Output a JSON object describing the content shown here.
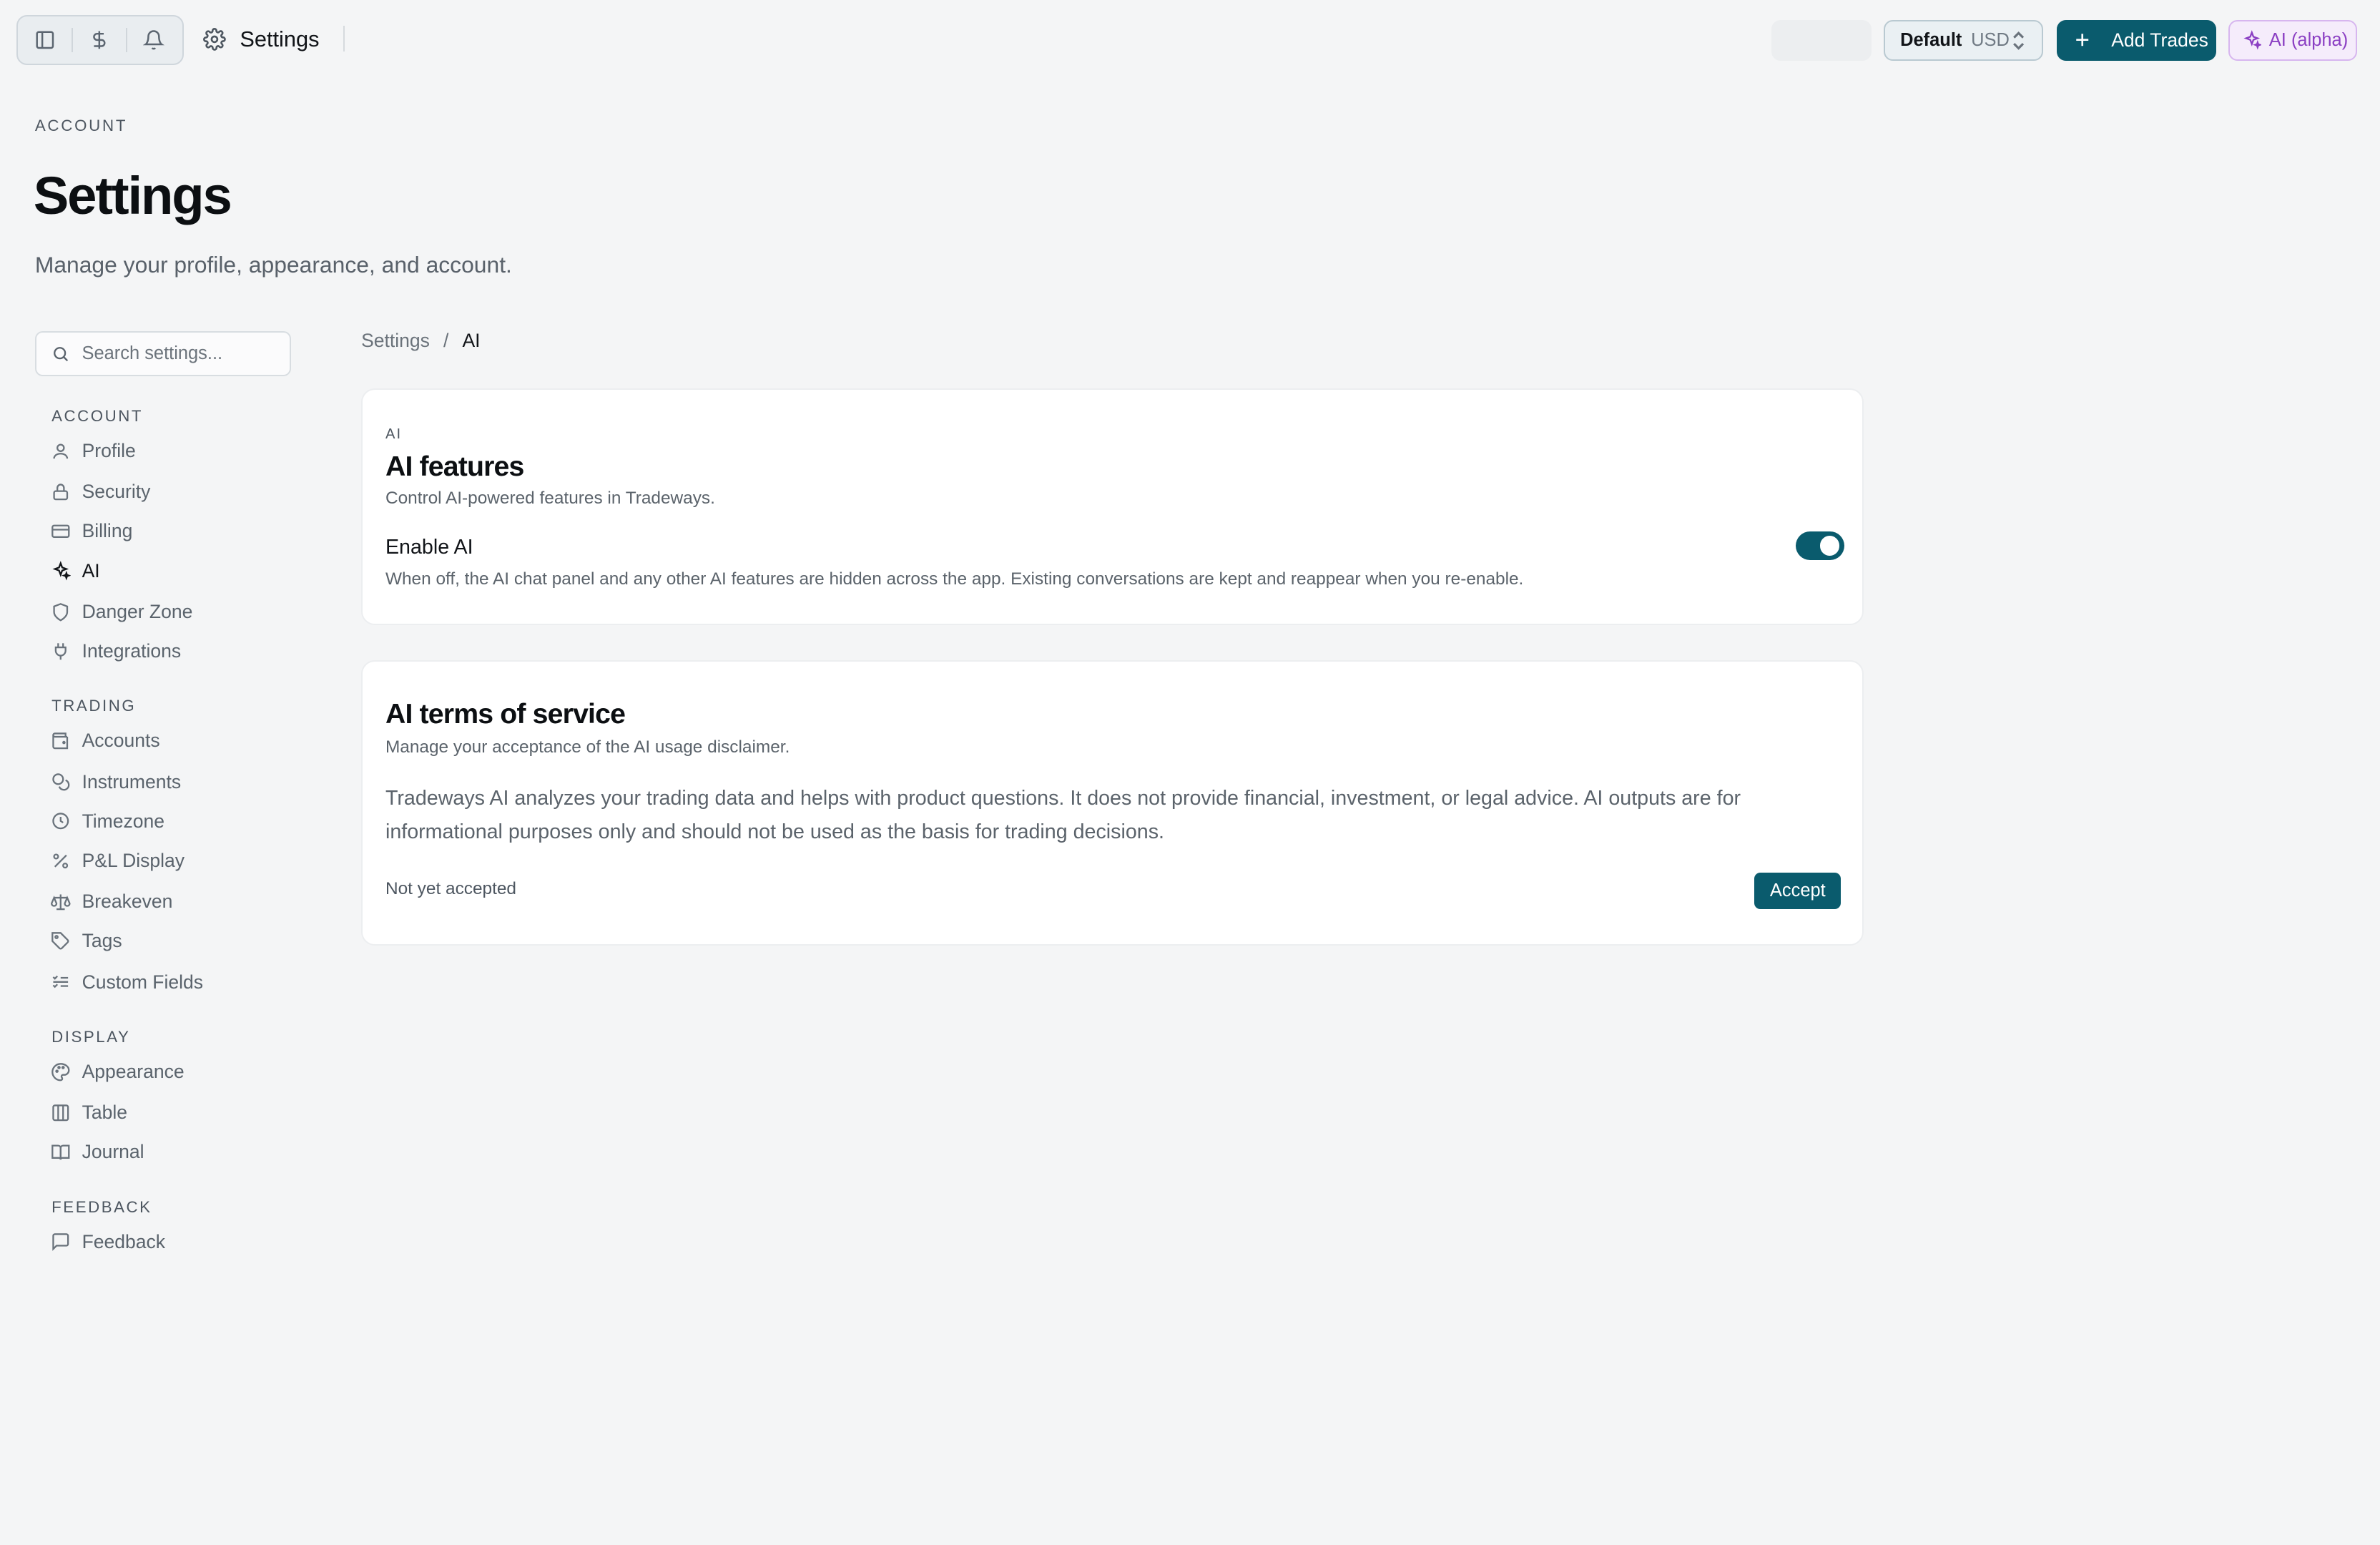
{
  "topbar": {
    "title": "Settings",
    "currency_select": {
      "profile": "Default",
      "currency": "USD"
    },
    "add_trades_label": "Add Trades",
    "ai_label": "AI (alpha)"
  },
  "header": {
    "eyebrow": "ACCOUNT",
    "title": "Settings",
    "subtitle": "Manage your profile, appearance, and account."
  },
  "search": {
    "placeholder": "Search settings..."
  },
  "sidebar": {
    "sections": [
      {
        "heading": "ACCOUNT",
        "items": [
          {
            "label": "Profile",
            "icon": "user-icon"
          },
          {
            "label": "Security",
            "icon": "lock-icon"
          },
          {
            "label": "Billing",
            "icon": "credit-card-icon"
          },
          {
            "label": "AI",
            "icon": "sparkles-icon",
            "active": true
          },
          {
            "label": "Danger Zone",
            "icon": "shield-icon"
          },
          {
            "label": "Integrations",
            "icon": "plug-icon"
          }
        ]
      },
      {
        "heading": "TRADING",
        "items": [
          {
            "label": "Accounts",
            "icon": "wallet-icon"
          },
          {
            "label": "Instruments",
            "icon": "coins-icon"
          },
          {
            "label": "Timezone",
            "icon": "clock-icon"
          },
          {
            "label": "P&L Display",
            "icon": "percent-icon"
          },
          {
            "label": "Breakeven",
            "icon": "scale-icon"
          },
          {
            "label": "Tags",
            "icon": "tag-icon"
          },
          {
            "label": "Custom Fields",
            "icon": "list-checks-icon"
          }
        ]
      },
      {
        "heading": "DISPLAY",
        "items": [
          {
            "label": "Appearance",
            "icon": "palette-icon"
          },
          {
            "label": "Table",
            "icon": "columns-icon"
          },
          {
            "label": "Journal",
            "icon": "book-icon"
          }
        ]
      },
      {
        "heading": "FEEDBACK",
        "items": [
          {
            "label": "Feedback",
            "icon": "message-square-icon"
          }
        ]
      }
    ]
  },
  "breadcrumb": {
    "root": "Settings",
    "separator": "/",
    "current": "AI"
  },
  "ai_features": {
    "eyebrow": "AI",
    "title": "AI features",
    "subtitle": "Control AI-powered features in Tradeways.",
    "toggle_label": "Enable AI",
    "toggle_help": "When off, the AI chat panel and any other AI features are hidden across the app. Existing conversations are kept and reappear when you re-enable.",
    "enabled": true
  },
  "ai_terms": {
    "title": "AI terms of service",
    "subtitle": "Manage your acceptance of the AI usage disclaimer.",
    "text": "Tradeways AI analyzes your trading data and helps with product questions. It does not provide financial, investment, or legal advice. AI outputs are for informational purposes only and should not be used as the basis for trading decisions.",
    "status": "Not yet accepted",
    "accept_label": "Accept"
  },
  "colors": {
    "primary": "#0a5b6d",
    "ai_accent": "#8b3fc3",
    "background": "#f4f5f6"
  }
}
